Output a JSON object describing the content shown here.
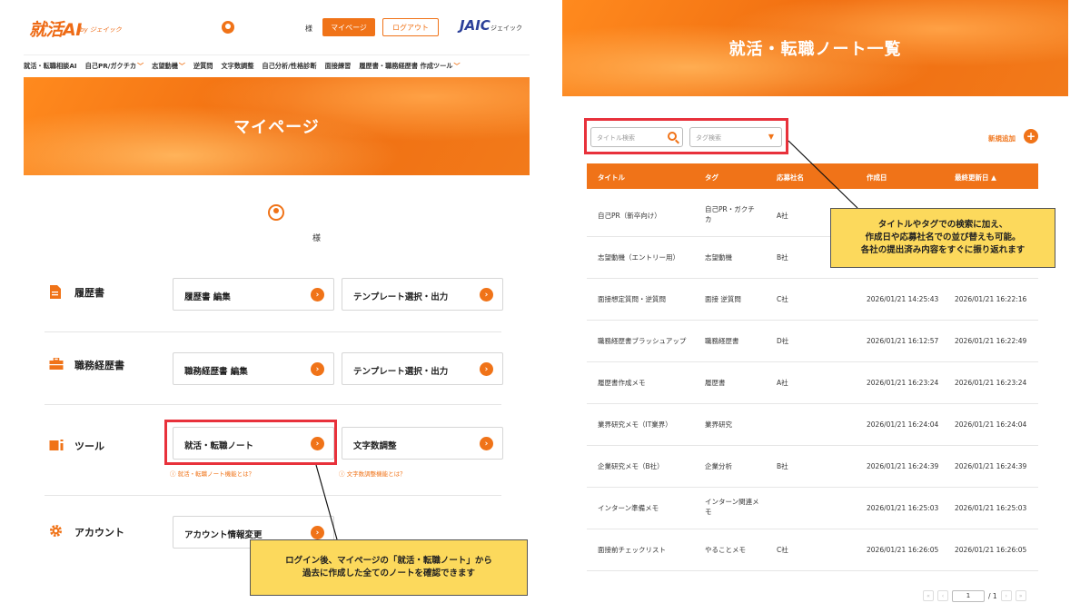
{
  "left": {
    "header": {
      "logo": "就活AI",
      "logo_sub": "by ジェイック",
      "user_suffix": "様",
      "mypage_button": "マイページ",
      "logout_button": "ログアウト",
      "partner_logo": "JAIC",
      "partner_name": "ジェイック"
    },
    "nav": [
      {
        "label": "就活・転職相談AI",
        "dropdown": false
      },
      {
        "label": "自己PR/ガクチカ",
        "dropdown": true
      },
      {
        "label": "志望動機",
        "dropdown": true
      },
      {
        "label": "逆質問",
        "dropdown": false
      },
      {
        "label": "文字数調整",
        "dropdown": false
      },
      {
        "label": "自己分析/性格診断",
        "dropdown": false
      },
      {
        "label": "面接練習",
        "dropdown": false
      },
      {
        "label": "履歴書・職務経歴書 作成ツール",
        "dropdown": true
      }
    ],
    "hero_title": "マイページ",
    "user_suffix": "様",
    "sections": [
      {
        "label": "履歴書",
        "cards": [
          "履歴書 編集",
          "テンプレート選択・出力"
        ],
        "hints": []
      },
      {
        "label": "職務経歴書",
        "cards": [
          "職務経歴書 編集",
          "テンプレート選択・出力"
        ],
        "hints": []
      },
      {
        "label": "ツール",
        "cards": [
          "就活・転職ノート",
          "文字数調整"
        ],
        "hints": [
          "就活・転職ノート機能とは？",
          "文字数調整機能とは？"
        ]
      },
      {
        "label": "アカウント",
        "cards": [
          "アカウント情報変更"
        ],
        "hints": []
      }
    ],
    "callout": {
      "line1": "ログイン後、マイページの「就活・転職ノート」から",
      "line2": "過去に作成した全てのノートを確認できます"
    }
  },
  "right": {
    "hero_title": "就活・転職ノート一覧",
    "search": {
      "title_placeholder": "タイトル検索",
      "tag_placeholder": "タグ検索"
    },
    "new_label": "新規追加",
    "columns": [
      "タイトル",
      "タグ",
      "応募社名",
      "作成日",
      "最終更新日 ▲"
    ],
    "rows": [
      [
        "自己PR（新卒向け）",
        "自己PR・ガクチ\nカ",
        "A社",
        "",
        ""
      ],
      [
        "志望動機（エントリー用）",
        "志望動機",
        "B社",
        "",
        ""
      ],
      [
        "面接想定質問・逆質問",
        "面接 逆質問",
        "C社",
        "2026/01/21 14:25:43",
        "2026/01/21 16:22:16"
      ],
      [
        "職務経歴書ブラッシュアップ",
        "職務経歴書",
        "D社",
        "2026/01/21 16:12:57",
        "2026/01/21 16:22:49"
      ],
      [
        "履歴書作成メモ",
        "履歴書",
        "A社",
        "2026/01/21 16:23:24",
        "2026/01/21 16:23:24"
      ],
      [
        "業界研究メモ（IT業界）",
        "業界研究",
        "",
        "2026/01/21 16:24:04",
        "2026/01/21 16:24:04"
      ],
      [
        "企業研究メモ（B社）",
        "企業分析",
        "B社",
        "2026/01/21 16:24:39",
        "2026/01/21 16:24:39"
      ],
      [
        "インターン準備メモ",
        "インターン関連メ\nモ",
        "",
        "2026/01/21 16:25:03",
        "2026/01/21 16:25:03"
      ],
      [
        "面接前チェックリスト",
        "やることメモ",
        "C社",
        "2026/01/21 16:26:05",
        "2026/01/21 16:26:05"
      ]
    ],
    "pager": {
      "first": "«",
      "prev": "‹",
      "current": "1",
      "total": "/ 1",
      "next": "›",
      "last": "»"
    },
    "callout": {
      "line1": "タイトルやタグでの検索に加え、",
      "line2": "作成日や応募社名での並び替えも可能。",
      "line3": "各社の提出済み内容をすぐに振り返れます"
    }
  },
  "colors": {
    "accent": "#f07318",
    "highlight": "#e8313b",
    "callout": "#fcd95c",
    "partner": "#2b3f99"
  }
}
